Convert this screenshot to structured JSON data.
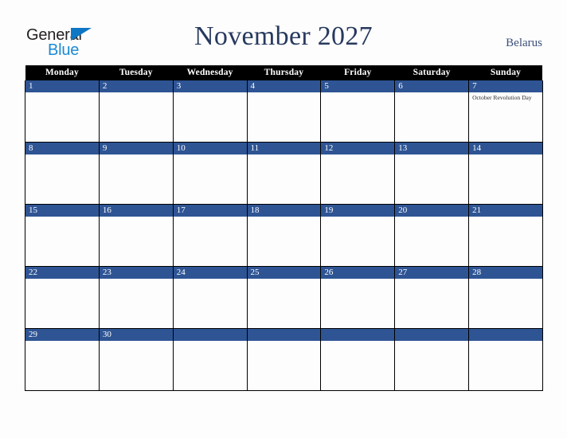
{
  "brand": {
    "line1": "General",
    "line2": "Blue",
    "triangle_color": "#0d77c4",
    "line1_color": "#231f20",
    "line2_color": "#1b8ad4"
  },
  "header": {
    "title": "November 2027",
    "country": "Belarus",
    "title_color": "#27395e",
    "country_color": "#3a4f7a"
  },
  "colors": {
    "page_background": "#fdfdfd",
    "weekday_header_background": "#000000",
    "weekday_header_text": "#ffffff",
    "date_band_background": "#2e5494",
    "date_band_text": "#ffffff",
    "cell_border": "#000000",
    "cell_background": "#fdfdfd",
    "event_text": "#2b2b2b"
  },
  "calendar": {
    "month": "November",
    "year": "2027",
    "weekdays": [
      "Monday",
      "Tuesday",
      "Wednesday",
      "Thursday",
      "Friday",
      "Saturday",
      "Sunday"
    ],
    "weeks": [
      [
        {
          "day": "1",
          "event": ""
        },
        {
          "day": "2",
          "event": ""
        },
        {
          "day": "3",
          "event": ""
        },
        {
          "day": "4",
          "event": ""
        },
        {
          "day": "5",
          "event": ""
        },
        {
          "day": "6",
          "event": ""
        },
        {
          "day": "7",
          "event": "October Revolution Day"
        }
      ],
      [
        {
          "day": "8",
          "event": ""
        },
        {
          "day": "9",
          "event": ""
        },
        {
          "day": "10",
          "event": ""
        },
        {
          "day": "11",
          "event": ""
        },
        {
          "day": "12",
          "event": ""
        },
        {
          "day": "13",
          "event": ""
        },
        {
          "day": "14",
          "event": ""
        }
      ],
      [
        {
          "day": "15",
          "event": ""
        },
        {
          "day": "16",
          "event": ""
        },
        {
          "day": "17",
          "event": ""
        },
        {
          "day": "18",
          "event": ""
        },
        {
          "day": "19",
          "event": ""
        },
        {
          "day": "20",
          "event": ""
        },
        {
          "day": "21",
          "event": ""
        }
      ],
      [
        {
          "day": "22",
          "event": ""
        },
        {
          "day": "23",
          "event": ""
        },
        {
          "day": "24",
          "event": ""
        },
        {
          "day": "25",
          "event": ""
        },
        {
          "day": "26",
          "event": ""
        },
        {
          "day": "27",
          "event": ""
        },
        {
          "day": "28",
          "event": ""
        }
      ],
      [
        {
          "day": "29",
          "event": ""
        },
        {
          "day": "30",
          "event": ""
        },
        {
          "day": "",
          "event": ""
        },
        {
          "day": "",
          "event": ""
        },
        {
          "day": "",
          "event": ""
        },
        {
          "day": "",
          "event": ""
        },
        {
          "day": "",
          "event": ""
        }
      ]
    ]
  }
}
